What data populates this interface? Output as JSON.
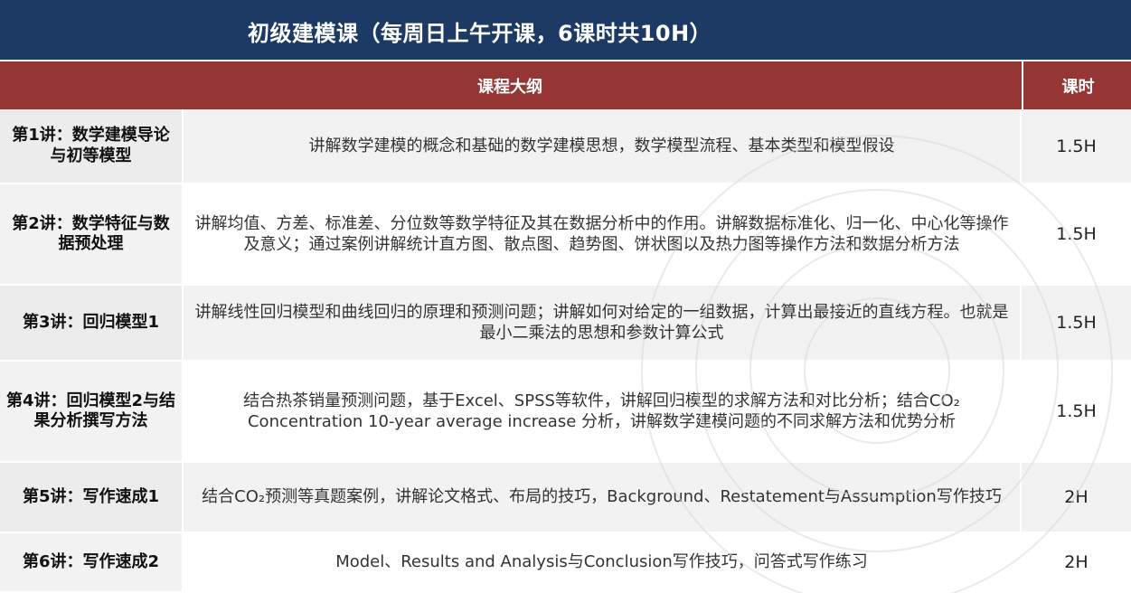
{
  "title": "初级建模课（每周日上午开课，6课时共10H）",
  "header": {
    "outline": "课程大纲",
    "hours": "课时"
  },
  "rows": [
    {
      "lecture": "第1讲：数学建模导论与初等模型",
      "desc": "讲解数学建模的概念和基础的数学建模思想，数学模型流程、基本类型和模型假设",
      "hours": "1.5H"
    },
    {
      "lecture": "第2讲：数学特征与数据预处理",
      "desc": "讲解均值、方差、标准差、分位数等数学特征及其在数据分析中的作用。讲解数据标准化、归一化、中心化等操作及意义；通过案例讲解统计直方图、散点图、趋势图、饼状图以及热力图等操作方法和数据分析方法",
      "hours": "1.5H"
    },
    {
      "lecture": "第3讲：回归模型1",
      "desc": "讲解线性回归模型和曲线回归的原理和预测问题；讲解如何对给定的一组数据，计算出最接近的直线方程。也就是最小二乘法的思想和参数计算公式",
      "hours": "1.5H"
    },
    {
      "lecture": "第4讲：回归模型2与结果分析撰写方法",
      "desc": "结合热茶销量预测问题，基于Excel、SPSS等软件，讲解回归模型的求解方法和对比分析；结合CO₂ Concentration 10-year average increase 分析，讲解数学建模问题的不同求解方法和优势分析",
      "hours": "1.5H"
    },
    {
      "lecture": "第5讲：写作速成1",
      "desc": "结合CO₂预测等真题案例，讲解论文格式、布局的技巧，Background、Restatement与Assumption写作技巧",
      "hours": "2H"
    },
    {
      "lecture": "第6讲：写作速成2",
      "desc": "Model、Results and Analysis与Conclusion写作技巧，问答式写作练习",
      "hours": "2H"
    }
  ]
}
